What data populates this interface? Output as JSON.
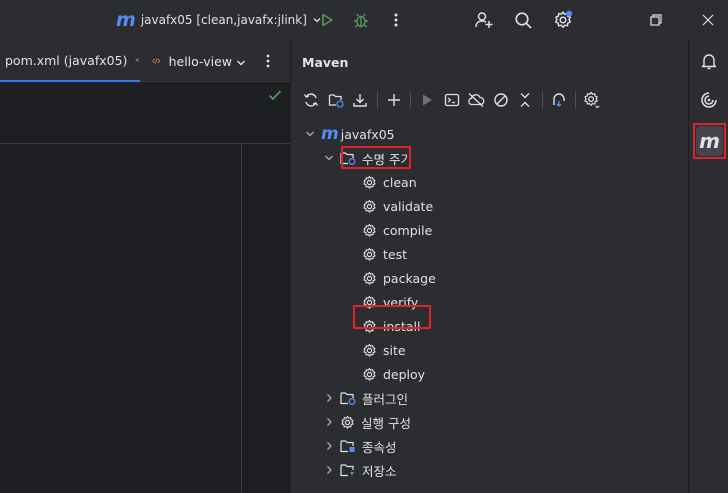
{
  "titlebar": {
    "run_config_logo": "m",
    "run_config_label": "javafx05 [clean,javafx:jlink]",
    "icons": [
      "run-icon",
      "debug-icon",
      "more-vert-icon",
      "add-user-icon",
      "search-icon",
      "settings-icon",
      "restore-window-icon",
      "close-window-icon"
    ]
  },
  "editor": {
    "tabs": [
      {
        "label": "pom.xml (javafx05)",
        "active": true
      },
      {
        "label": "hello-view",
        "active": false
      }
    ]
  },
  "maven": {
    "title": "Maven",
    "toolbar": [
      "reload-icon",
      "add-project-icon",
      "download-icon",
      "plus-icon",
      "run-icon",
      "execute-goal-icon",
      "offline-icon",
      "skip-tests-icon",
      "collapse-icon",
      "analyze-icon",
      "settings-icon"
    ],
    "tree": {
      "project": {
        "logo": "m",
        "label": "javafx05"
      },
      "lifecycle": {
        "label": "수명 주기",
        "goals": [
          "clean",
          "validate",
          "compile",
          "test",
          "package",
          "verify",
          "install",
          "site",
          "deploy"
        ]
      },
      "plugins": "플러그인",
      "run_configs": "실행 구성",
      "dependencies": "종속성",
      "repositories": "저장소"
    }
  },
  "right_strip": [
    "notifications-icon",
    "ai-assistant-icon",
    "maven-icon"
  ],
  "colors": {
    "accent": "#3574f0",
    "highlight": "#e0232a",
    "run_green": "#57965c",
    "maven_blue": "#548af7"
  }
}
